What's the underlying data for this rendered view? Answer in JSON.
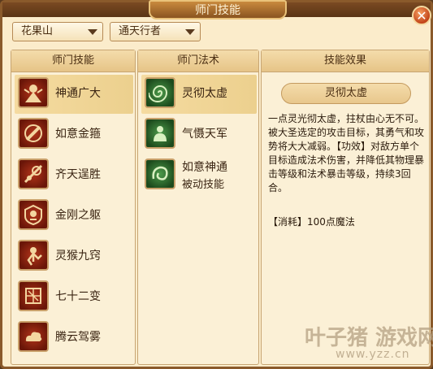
{
  "window": {
    "title": "师门技能"
  },
  "filters": {
    "school": "花果山",
    "mode": "通天行者"
  },
  "skills_panel": {
    "header": "师门技能",
    "items": [
      {
        "label": "神通广大",
        "icon": "monkey-king-icon",
        "selected": true
      },
      {
        "label": "如意金箍",
        "icon": "golden-staff-icon",
        "selected": false
      },
      {
        "label": "齐天逞胜",
        "icon": "cudgel-spin-icon",
        "selected": false
      },
      {
        "label": "金刚之躯",
        "icon": "vajra-body-icon",
        "selected": false
      },
      {
        "label": "灵猴九窍",
        "icon": "spirit-monkey-icon",
        "selected": false
      },
      {
        "label": "七十二变",
        "icon": "transformation-icon",
        "selected": false
      },
      {
        "label": "腾云驾雾",
        "icon": "cloud-icon",
        "selected": false
      }
    ]
  },
  "spells_panel": {
    "header": "师门法术",
    "items": [
      {
        "label": "灵彻太虚",
        "sub": "",
        "icon": "spiral-spell-icon",
        "selected": true
      },
      {
        "label": "气慑天军",
        "sub": "",
        "icon": "buddha-spell-icon",
        "selected": false
      },
      {
        "label": "如意神通",
        "sub": "被动技能",
        "icon": "swirl-spell-icon",
        "selected": false
      }
    ]
  },
  "effect_panel": {
    "header": "技能效果",
    "name": "灵彻太虚",
    "description": "一点灵光彻太虚，拄杖由心无不可。被大圣选定的攻击目标，其勇气和攻势将大大减弱。【功效】对敌方单个目标造成法术伤害，并降低其物理暴击等级和法术暴击等级，持续3回合。",
    "cost": "【消耗】100点魔法"
  },
  "watermark": {
    "text": "叶子猪 游戏网",
    "url": "www.yzz.cn"
  },
  "colors": {
    "accent": "#8a5a2b",
    "panel_bg": "#fbf0d6",
    "selected_row": "#f5dba0"
  }
}
